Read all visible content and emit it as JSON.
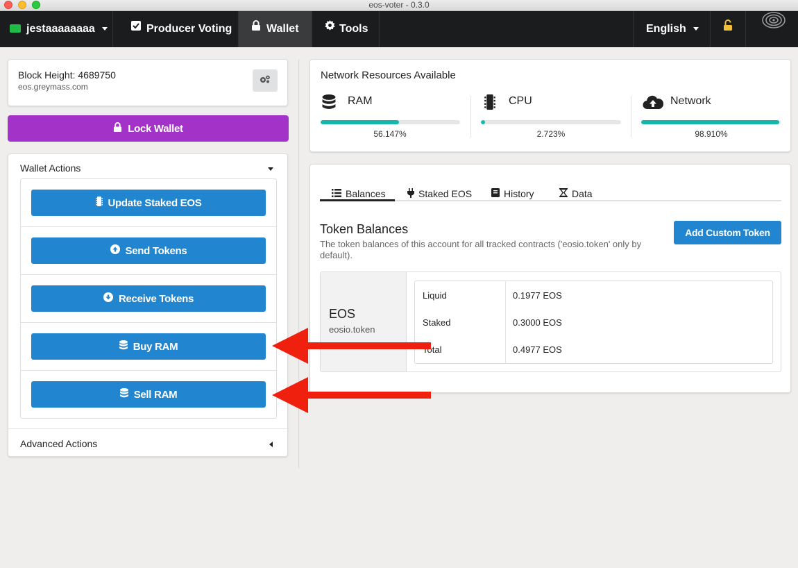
{
  "window": {
    "title": "eos-voter - 0.3.0"
  },
  "nav": {
    "account": "jestaaaaaaaa",
    "producer_voting": "Producer Voting",
    "wallet": "Wallet",
    "tools": "Tools",
    "language": "English"
  },
  "block_info": {
    "label": "Block Height: 4689750",
    "node": "eos.greymass.com"
  },
  "lock_wallet": "Lock Wallet",
  "wallet_actions": {
    "title": "Wallet Actions",
    "buttons": [
      "Update Staked EOS",
      "Send Tokens",
      "Receive Tokens",
      "Buy RAM",
      "Sell RAM"
    ]
  },
  "advanced_actions": {
    "title": "Advanced Actions"
  },
  "resources": {
    "title": "Network Resources Available",
    "items": [
      {
        "label": "RAM",
        "percent_text": "56.147%",
        "value": 56.147,
        "icon": "database-icon"
      },
      {
        "label": "CPU",
        "percent_text": "2.723%",
        "value": 2.723,
        "icon": "microchip-icon"
      },
      {
        "label": "Network",
        "percent_text": "98.910%",
        "value": 98.91,
        "icon": "cloud-upload-icon"
      }
    ]
  },
  "tabs": [
    "Balances",
    "Staked EOS",
    "History",
    "Data"
  ],
  "token_balances": {
    "title": "Token Balances",
    "description": "The token balances of this account for all tracked contracts ('eosio.token' only by default).",
    "add_button": "Add Custom Token",
    "token": {
      "symbol": "EOS",
      "contract": "eosio.token"
    },
    "rows": [
      {
        "label": "Liquid",
        "value": "0.1977 EOS"
      },
      {
        "label": "Staked",
        "value": "0.3000 EOS"
      },
      {
        "label": "Total",
        "value": "0.4977 EOS"
      }
    ]
  },
  "colors": {
    "accent_blue": "#2185d0",
    "lock_purple": "#a333c8",
    "progress_teal": "#17b6ad",
    "nav_bg": "#1b1c1d",
    "annotation_arrow": "#f0200e",
    "unlock_icon": "#f2c037"
  }
}
